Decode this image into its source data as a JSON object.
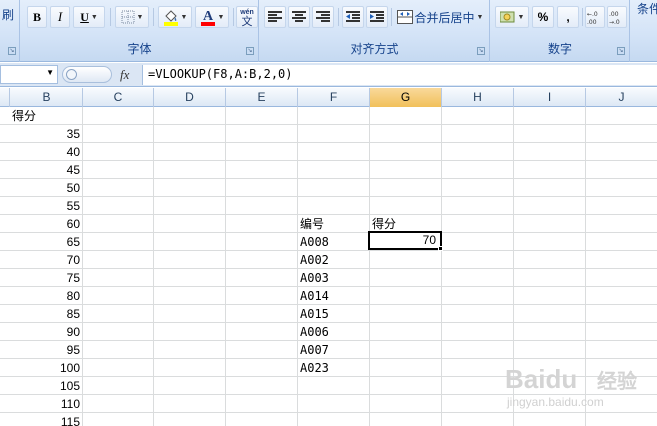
{
  "ribbon": {
    "left_partial_label": "刷",
    "right_partial_label": "条件",
    "font_group": {
      "label": "字体",
      "bold": "B",
      "italic": "I",
      "underline": "U",
      "phonetic_icon_text": "wén",
      "phonetic_icon_char": "文",
      "font_color_letter": "A",
      "fill_color": "#ffff00",
      "font_color": "#ff0000"
    },
    "align_group": {
      "label": "对齐方式",
      "merge_center": "合并后居中"
    },
    "number_group": {
      "label": "数字",
      "percent": "%",
      "comma": ",",
      "increase_decimal": "+.0 .00",
      "decrease_decimal": ".00 →.0"
    }
  },
  "formula_bar": {
    "name_box": "",
    "fx": "fx",
    "formula": "=VLOOKUP(F8,A:B,2,0)"
  },
  "columns": [
    "B",
    "C",
    "D",
    "E",
    "F",
    "G",
    "H",
    "I",
    "J"
  ],
  "selected_column": "G",
  "sheet": {
    "b_header": "得分",
    "b_values": [
      "35",
      "40",
      "45",
      "50",
      "55",
      "60",
      "65",
      "70",
      "75",
      "80",
      "85",
      "90",
      "95",
      "100",
      "105",
      "110",
      "115"
    ],
    "f_header": "编号",
    "f_values": [
      "A008",
      "A002",
      "A003",
      "A014",
      "A015",
      "A006",
      "A007",
      "A023"
    ],
    "g_header": "得分",
    "g_result": "70"
  },
  "watermark": {
    "brand": "Baidu",
    "brand_cn": "经验",
    "url": "jingyan.baidu.com"
  }
}
